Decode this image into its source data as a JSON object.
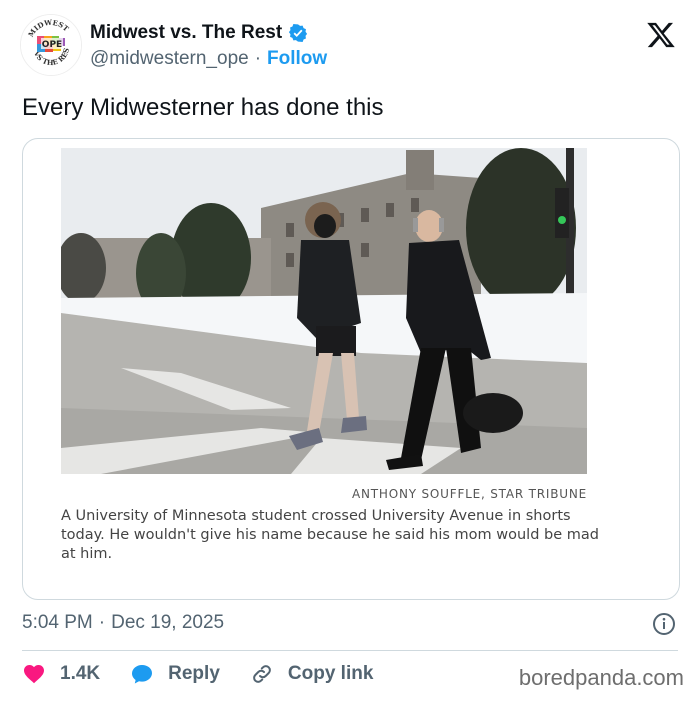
{
  "author": {
    "display_name": "Midwest vs. The Rest",
    "handle": "@midwestern_ope",
    "separator": "·",
    "follow_label": "Follow",
    "avatar_text": {
      "top": "MIDWEST",
      "middle": "OPE",
      "bottom": "VS THE REST"
    }
  },
  "tweet": {
    "text": "Every Midwesterner has done this"
  },
  "media": {
    "credit": "ANTHONY SOUFFLE, STAR TRIBUNE",
    "caption": "A University of Minnesota student crossed University Avenue in shorts today. He wouldn't give his name because he said his mom would be mad at him."
  },
  "meta": {
    "time": "5:04 PM",
    "separator": "·",
    "date": "Dec 19, 2025"
  },
  "actions": {
    "likes": "1.4K",
    "reply_label": "Reply",
    "copy_label": "Copy link"
  },
  "watermark": "boredpanda.com",
  "colors": {
    "brand_blue": "#1d9bf0",
    "heart": "#f91880",
    "muted": "#536471",
    "text": "#0f1419"
  }
}
